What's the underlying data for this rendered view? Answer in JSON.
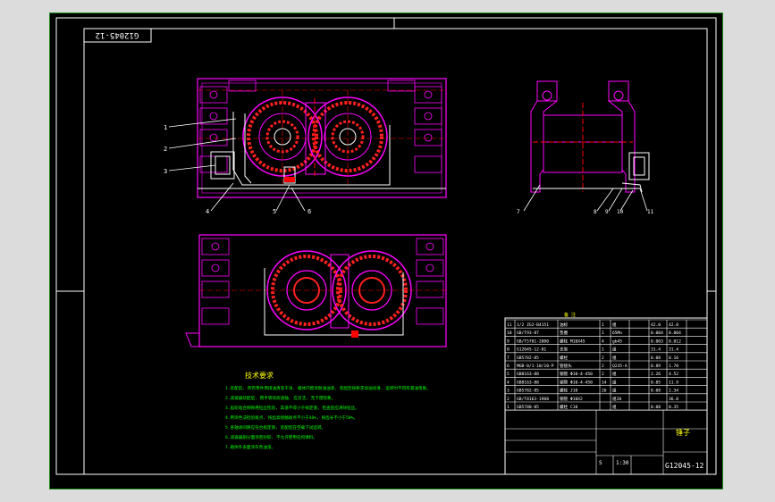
{
  "drawing": {
    "title_block_code_top": "G12045-12",
    "drawing_number": "G12045-12",
    "title_cell": "锤子",
    "scale": "1:30",
    "sheet_s": "S",
    "notes_title": "技术要求",
    "notes": [
      "1.装配前, 所有零件用煤油清洗干净, 箱体内壁涂耐油油漆, 装配后按要求加油润滑, 运转时不得有漏油现象。",
      "2.减速器装配后, 用手转动高速轴, 应灵活, 无卡阻现象。",
      "3.齿轮啮合侧隙用铅丝检验, 其值不得小于规定值, 检查后应清除铅丝。",
      "4.用涂色法检验斑点, 按齿高接触斑点不小于40%, 按齿长不小于50%。",
      "5.各轴承间隙应符合规定值, 装配后在空载下试运转。",
      "6.减速器剖分面涂密封胶, 不允许使用任何填料。",
      "7.箱体外表面涂灰色油漆。"
    ],
    "callouts": [
      "1",
      "2",
      "3",
      "4",
      "5",
      "6",
      "7",
      "8",
      "9",
      "10",
      "11"
    ],
    "bom_header_note": "备 注",
    "bom_rows": [
      {
        "no": "11",
        "code": "1/2 ZG2-B4151",
        "name": "油标",
        "qty": "1",
        "mat": "组",
        "w1": "42.0",
        "w2": "42.0"
      },
      {
        "no": "10",
        "code": "GB/T93-87",
        "name": "垫圈",
        "qty": "1",
        "mat": "65Mn",
        "w1": "0.004",
        "w2": "0.004"
      },
      {
        "no": "9",
        "code": "GB/T5781-2000",
        "name": "螺栓 M10X45",
        "qty": "4",
        "mat": "gb45",
        "w1": "0.003",
        "w2": "0.012"
      },
      {
        "no": "8",
        "code": "G12045-12-01",
        "name": "支架",
        "qty": "1",
        "mat": "组",
        "w1": "31.4",
        "w2": "31.4"
      },
      {
        "no": "7",
        "code": "GB5782-85",
        "name": "螺栓",
        "qty": "2",
        "mat": "组",
        "w1": "0.08",
        "w2": "0.16"
      },
      {
        "no": "6",
        "code": "MGB-8/1-10/10-P",
        "name": "管接头",
        "qty": "2",
        "mat": "Q235-A",
        "w1": "0.89",
        "w2": "1.78"
      },
      {
        "no": "5",
        "code": "GB8163-88",
        "name": "钢管 Φ10-4-450",
        "qty": "2",
        "mat": "组",
        "w1": "2.26",
        "w2": "4.52"
      },
      {
        "no": "4",
        "code": "GB8163-88",
        "name": "钢管 Φ10-4-450",
        "qty": "14",
        "mat": "组",
        "w1": "0.85",
        "w2": "11.9"
      },
      {
        "no": "3",
        "code": "GB5782-85",
        "name": "螺栓 J10",
        "qty": "26",
        "mat": "组",
        "w1": "0.08",
        "w2": "2.34"
      },
      {
        "no": "2",
        "code": "GB/T8163-1988",
        "name": "钢管 Φ10X2",
        "qty": "",
        "mat": "组20",
        "w1": "",
        "w2": "36.0"
      },
      {
        "no": "1",
        "code": "GB5780-85",
        "name": "螺栓 C10",
        "qty": "",
        "mat": "组",
        "w1": "0.08",
        "w2": "0.35"
      }
    ],
    "colors": {
      "frame": "#1f8f1f",
      "line": "#ffffff",
      "part": "#ff00ff",
      "gear": "#ff2020",
      "note": "#00ff00",
      "yellow": "#ffff00",
      "cyan": "#00ffff"
    }
  }
}
